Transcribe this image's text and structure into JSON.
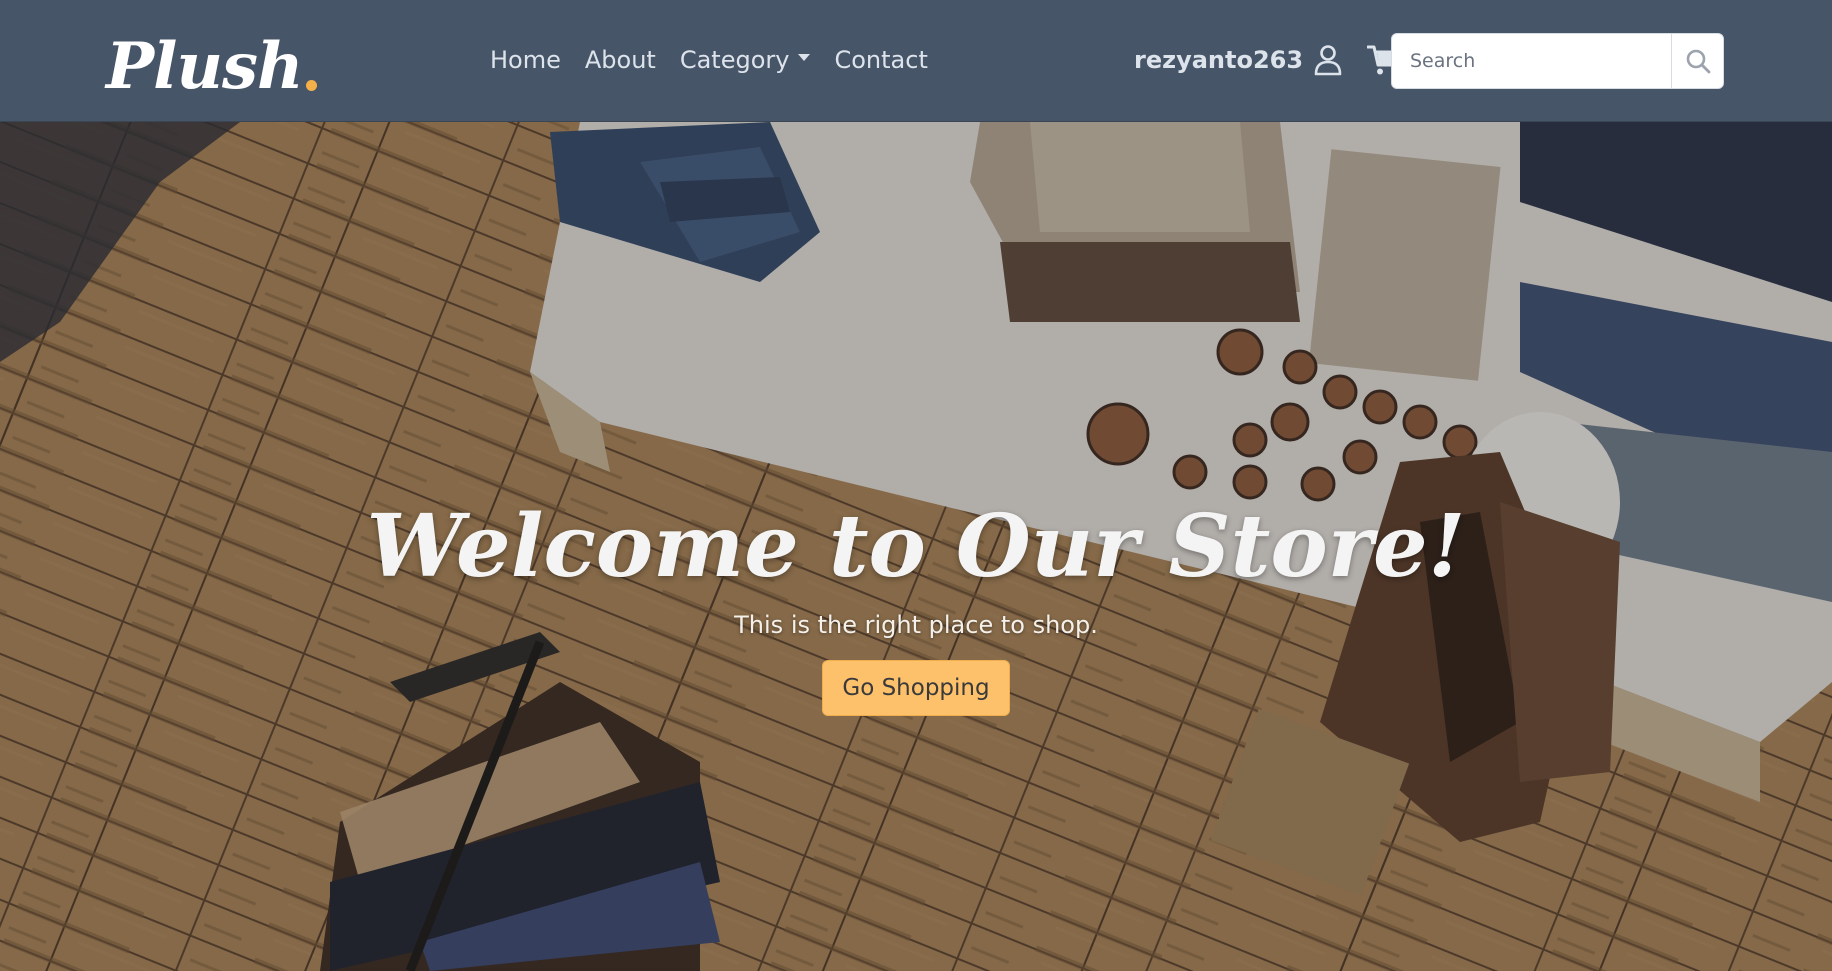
{
  "brand": {
    "name": "Plush",
    "accent_color": "#f5b04a"
  },
  "nav": {
    "links": [
      "Home",
      "About",
      "Category",
      "Contact"
    ],
    "dropdown_indicator": "chevron-down-icon"
  },
  "user": {
    "username": "rezyanto263",
    "icons": [
      "user-icon",
      "cart-icon"
    ]
  },
  "search": {
    "placeholder": "Search",
    "value": "",
    "icon": "search-icon"
  },
  "hero": {
    "title": "Welcome to Our Store!",
    "subtitle": "This is the right place to shop.",
    "cta_label": "Go Shopping",
    "cta_color": "#fdc16b"
  },
  "colors": {
    "navbar": "#475569",
    "nav_text": "#dde3ea"
  }
}
